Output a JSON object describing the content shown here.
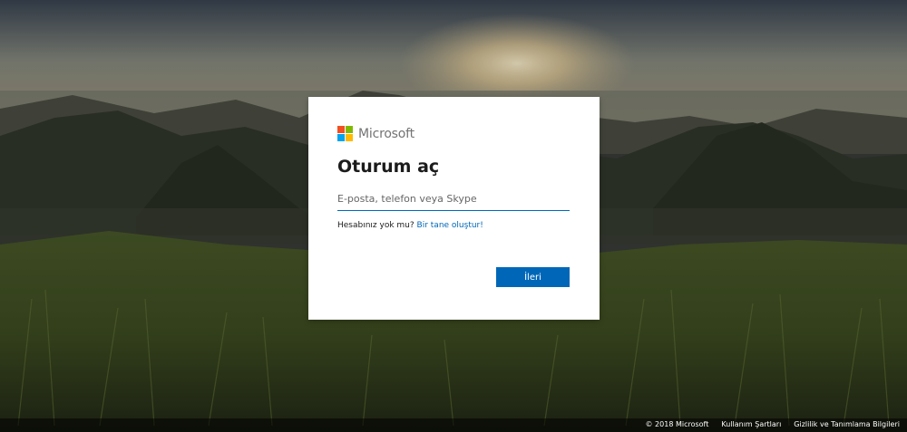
{
  "brand": {
    "name": "Microsoft",
    "logo_colors": [
      "#f25022",
      "#7fba00",
      "#00a4ef",
      "#ffb900"
    ]
  },
  "signin": {
    "title": "Oturum aç",
    "input_placeholder": "E-posta, telefon veya Skype",
    "input_value": "",
    "no_account_text": "Hesabınız yok mu?",
    "create_link": "Bir tane oluştur!",
    "next_label": "İleri"
  },
  "footer": {
    "copyright": "© 2018 Microsoft",
    "terms": "Kullanım Şartları",
    "privacy": "Gizlilik ve Tanımlama Bilgileri"
  },
  "colors": {
    "accent": "#0067b8",
    "title_text": "#1b1b1b",
    "brand_text": "#737373"
  }
}
